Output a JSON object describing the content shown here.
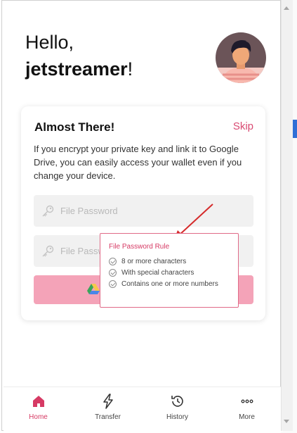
{
  "greeting": {
    "hello": "Hello,",
    "username": "jetstreamer",
    "punct": "!"
  },
  "card": {
    "title": "Almost There!",
    "skip": "Skip",
    "description": "If you encrypt your private key and link it to Google Drive, you can easily access your wallet even if you change your device.",
    "password_placeholder": "File Password",
    "confirm_placeholder": "File Password"
  },
  "tooltip": {
    "title": "File Password Rule",
    "rules": [
      "8 or more characters",
      "With special characters",
      "Contains one or more numbers"
    ]
  },
  "nav": [
    {
      "label": "Home",
      "icon": "home-icon",
      "active": true
    },
    {
      "label": "Transfer",
      "icon": "lightning-icon",
      "active": false
    },
    {
      "label": "History",
      "icon": "history-icon",
      "active": false
    },
    {
      "label": "More",
      "icon": "more-icon",
      "active": false
    }
  ],
  "colors": {
    "accent": "#d63a64",
    "button": "#f4a3b8",
    "field": "#f1f1f1"
  }
}
